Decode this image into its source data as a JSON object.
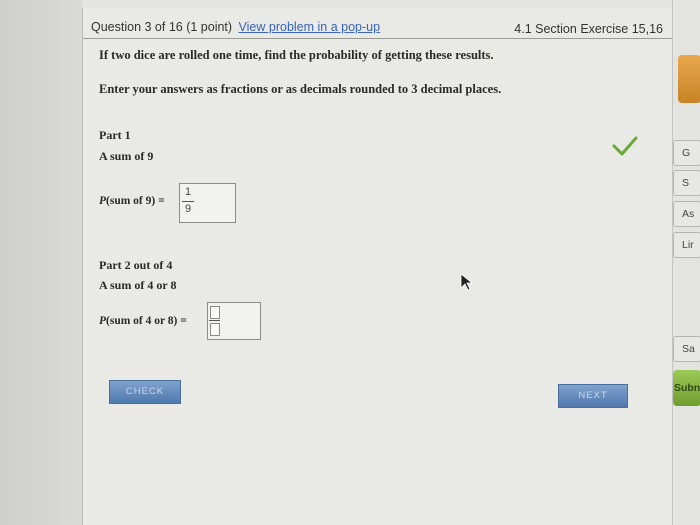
{
  "header": {
    "question_label": "Question 3 of 16 (1 point)",
    "popup_link": "View problem in a pop-up",
    "section": "4.1 Section Exercise 15,16"
  },
  "instructions": {
    "line1": "If two dice are rolled one time, find the probability of getting these results.",
    "line2": "Enter your answers as fractions or as decimals rounded to 3 decimal places."
  },
  "part1": {
    "title": "Part 1",
    "description": "A sum of 9",
    "equation_italic": "P",
    "equation_rest": "(sum of 9) =",
    "answer_numerator": "1",
    "answer_denominator": "9",
    "status": "correct"
  },
  "part2": {
    "title": "Part 2 out of 4",
    "description": "A sum of 4 or 8",
    "equation_italic": "P",
    "equation_rest": "(sum of 4 or 8) =",
    "answer_numerator": "",
    "answer_denominator": ""
  },
  "buttons": {
    "check": "CHECK",
    "next": "NEXT"
  },
  "side_panel": {
    "items": [
      "G",
      "S",
      "As",
      "Lir",
      "Sa",
      "Subn"
    ]
  },
  "colors": {
    "check_green": "#6aa83a",
    "link_blue": "#3a64b8",
    "button_blue": "#5a82b5",
    "side_green": "#84b544",
    "side_orange": "#d9953a"
  }
}
